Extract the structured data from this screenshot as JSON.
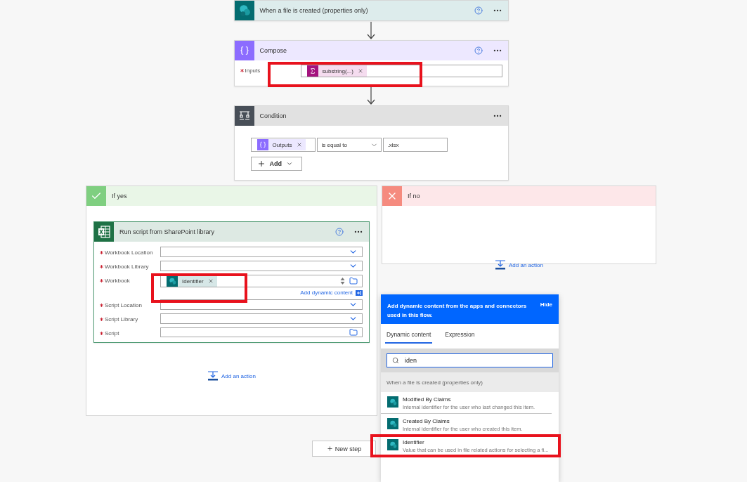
{
  "trigger": {
    "kind": "sharepoint",
    "title": "When a file is created (properties only)",
    "help": true
  },
  "compose": {
    "kind": "compose",
    "title": "Compose",
    "help": true,
    "fields": [
      {
        "label": "Inputs",
        "required": true,
        "token": {
          "kind": "expression",
          "label": "substring(...)"
        }
      }
    ]
  },
  "condition": {
    "kind": "condition",
    "title": "Condition",
    "left_token": {
      "kind": "compose",
      "label": "Outputs"
    },
    "operator": "is equal to",
    "value": ".xlsx",
    "add_button": "Add"
  },
  "branches": [
    {
      "kind": "yes",
      "title": "If yes",
      "actions": [
        {
          "kind": "excel",
          "title": "Run script from SharePoint library",
          "help": true,
          "fields": [
            {
              "label": "Workbook Location",
              "required": true,
              "kind": "dropdown"
            },
            {
              "label": "Workbook Library",
              "required": true,
              "kind": "dropdown"
            },
            {
              "label": "Workbook",
              "required": true,
              "kind": "file",
              "token": {
                "kind": "sharepoint",
                "label": "Identifier"
              },
              "link": "Add dynamic content"
            },
            {
              "label": "Script Location",
              "required": true,
              "kind": "dropdown"
            },
            {
              "label": "Script Library",
              "required": true,
              "kind": "dropdown"
            },
            {
              "label": "Script",
              "required": true,
              "kind": "file"
            }
          ]
        }
      ],
      "add_action": "Add an action"
    },
    {
      "kind": "no",
      "title": "If no",
      "add_action": "Add an action"
    }
  ],
  "new_step": "New step",
  "dynamic_panel": {
    "header": "Add dynamic content from the apps and connectors used in this flow.",
    "hide": "Hide",
    "tabs": [
      {
        "label": "Dynamic content",
        "selected": true
      },
      {
        "label": "Expression",
        "selected": false
      }
    ],
    "search": {
      "value": "iden"
    },
    "group": "When a file is created (properties only)",
    "items": [
      {
        "title": "Modified By Claims",
        "description": "Internal identifier for the user who last changed this item."
      },
      {
        "title": "Created By Claims",
        "description": "Internal identifier for the user who created this item."
      },
      {
        "title": "Identifier",
        "description": "Value that can be used in file related actions for selecting a fi..."
      }
    ]
  }
}
